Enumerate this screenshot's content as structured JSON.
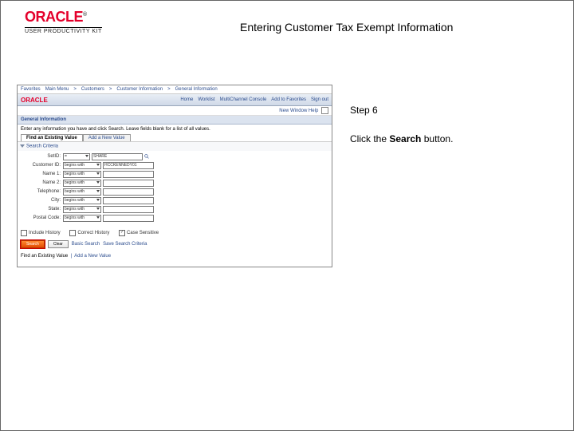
{
  "header": {
    "logo_text": "ORACLE",
    "logo_tm": "®",
    "logo_subtitle": "USER PRODUCTIVITY KIT"
  },
  "doc_title": "Entering Customer Tax Exempt Information",
  "side": {
    "step_label": "Step 6",
    "instruction_prefix": "Click the ",
    "instruction_bold": "Search",
    "instruction_suffix": " button."
  },
  "shot": {
    "nav_items": [
      "Favorites",
      "Main Menu",
      "Customers",
      "Customer Information",
      "General Information"
    ],
    "mini_logo": "ORACLE",
    "top_links": [
      "Home",
      "Worklist",
      "MultiChannel Console",
      "Add to Favorites",
      "Sign out"
    ],
    "sub_row_label": "New Window   Help",
    "section_title": "General Information",
    "section_desc": "Enter any information you have and click Search. Leave fields blank for a list of all values.",
    "tabs": {
      "active": "Find an Existing Value",
      "other": "Add a New Value"
    },
    "criteria_label": "Search Criteria",
    "form_rows": [
      {
        "label": "SetID:",
        "op": "=",
        "val": "SHARE",
        "lookup": true
      },
      {
        "label": "Customer ID:",
        "op": "begins with",
        "val": "HCCKENNEDY01",
        "lookup": false
      },
      {
        "label": "Name 1:",
        "op": "begins with",
        "val": "",
        "lookup": false
      },
      {
        "label": "Name 2:",
        "op": "begins with",
        "val": "",
        "lookup": false
      },
      {
        "label": "Telephone:",
        "op": "begins with",
        "val": "",
        "lookup": false
      },
      {
        "label": "City:",
        "op": "begins with",
        "val": "",
        "lookup": false
      },
      {
        "label": "State:",
        "op": "begins with",
        "val": "",
        "lookup": false
      },
      {
        "label": "Postal Code:",
        "op": "begins with",
        "val": "",
        "lookup": false
      }
    ],
    "checkboxes": [
      {
        "label": "Include History",
        "checked": false
      },
      {
        "label": "Correct History",
        "checked": false
      },
      {
        "label": "Case Sensitive",
        "checked": true
      }
    ],
    "buttons": {
      "search": "Search",
      "clear": "Clear",
      "basic": "Basic Search",
      "save": "Save Search Criteria"
    },
    "footer": {
      "label": "Find an Existing Value",
      "link": "Add a New Value"
    }
  }
}
